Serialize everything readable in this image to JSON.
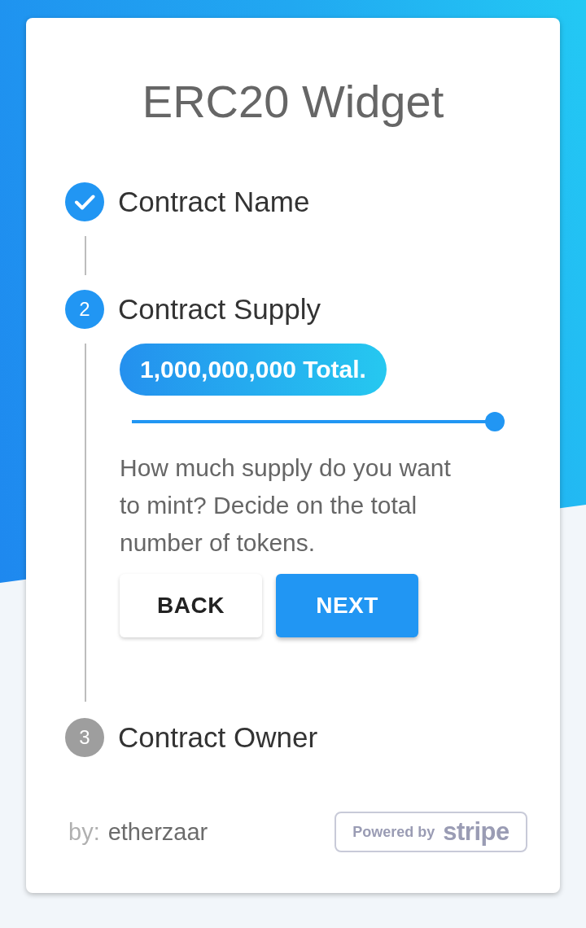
{
  "widget": {
    "title": "ERC20 Widget"
  },
  "steps": [
    {
      "label": "Contract Name",
      "completed": true,
      "selected": false
    },
    {
      "number": "2",
      "label": "Contract Supply",
      "completed": false,
      "selected": true,
      "content": {
        "total": "1,000,000,000 Total.",
        "slider": {
          "level": 1
        },
        "description": "How much supply do you want to mint? Decide on the total number of tokens.",
        "buttons": [
          {
            "label": "BACK",
            "kind": "secondary"
          },
          {
            "label": "NEXT",
            "kind": "primary"
          }
        ]
      }
    },
    {
      "number": "3",
      "label": "Contract Owner",
      "completed": false,
      "selected": false
    }
  ],
  "footer": {
    "by_label": "by:",
    "author": "etherzaar",
    "badge": {
      "prefix": "Powered by",
      "brand": "stripe"
    }
  }
}
